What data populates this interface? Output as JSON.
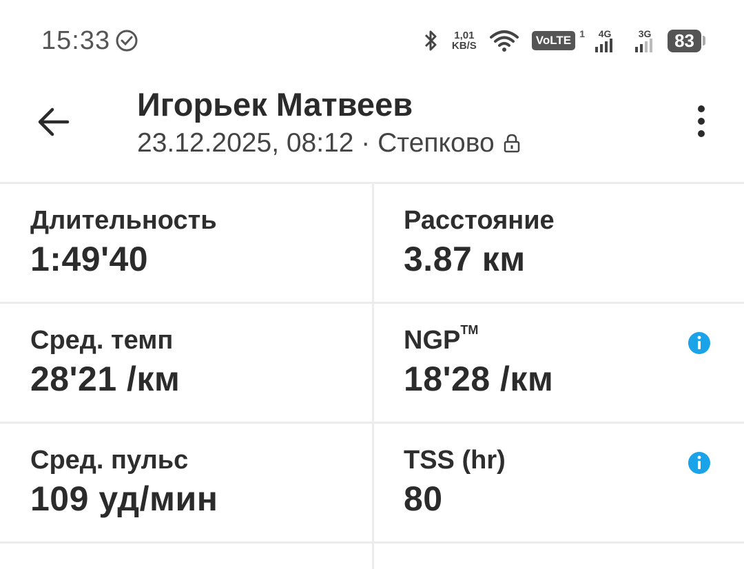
{
  "status_bar": {
    "time": "15:33",
    "speed_value": "1,01",
    "speed_unit": "KB/S",
    "volte": "VoLTE",
    "volte_sim": "1",
    "net1": "4G",
    "net2": "3G",
    "battery": "83"
  },
  "header": {
    "user_name": "Игорьек Матвеев",
    "datetime": "23.12.2025, 08:12 · Степково"
  },
  "stats": {
    "duration_label": "Длительность",
    "duration_value": "1:49'40",
    "distance_label": "Расстояние",
    "distance_value": "3.87 км",
    "avg_pace_label": "Сред. темп",
    "avg_pace_value": "28'21 /км",
    "ngp_label": "NGP",
    "ngp_tm": "TM",
    "ngp_value": "18'28 /км",
    "avg_hr_label": "Сред. пульс",
    "avg_hr_value": "109 уд/мин",
    "tss_label": "TSS (hr)",
    "tss_value": "80"
  },
  "colors": {
    "info_accent": "#1aa3e8",
    "divider": "#ececec",
    "text": "#2b2b2b"
  }
}
